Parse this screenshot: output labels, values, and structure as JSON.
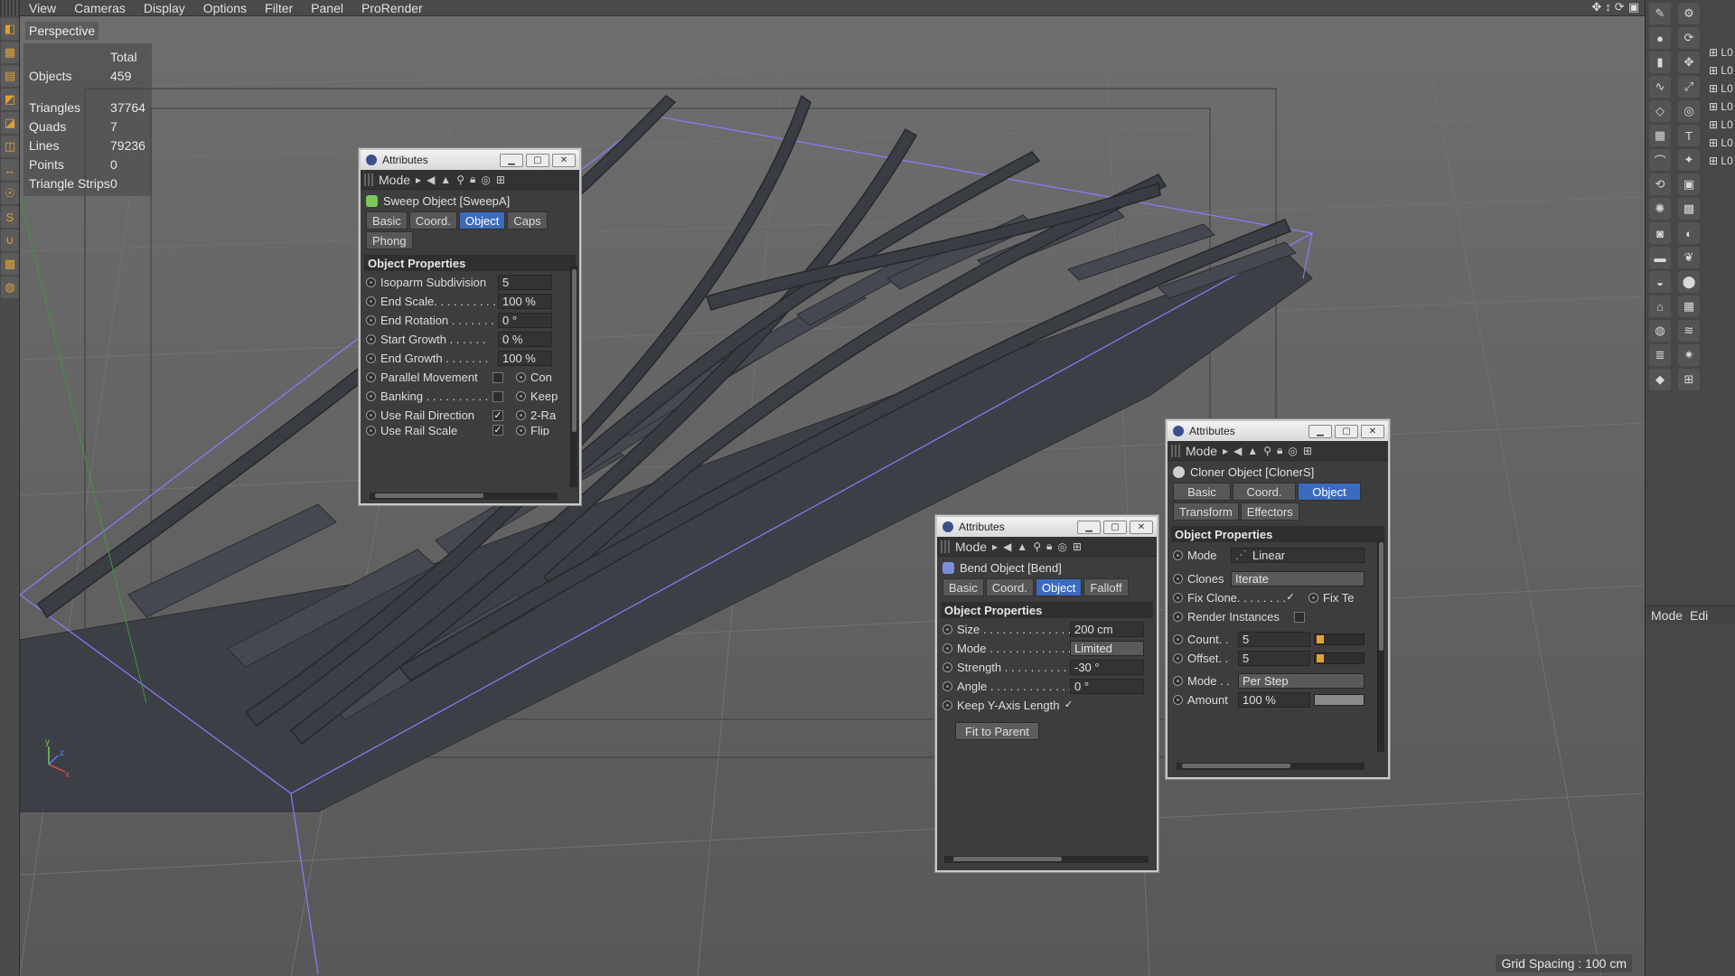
{
  "menu": {
    "items": [
      "View",
      "Cameras",
      "Display",
      "Options",
      "Filter",
      "Panel",
      "ProRender"
    ]
  },
  "viewport": {
    "name": "Perspective",
    "grid_spacing": "Grid Spacing : 100 cm"
  },
  "stats": {
    "total_label": "Total",
    "objects_label": "Objects",
    "objects_value": "459",
    "triangles_label": "Triangles",
    "triangles_value": "37764",
    "quads_label": "Quads",
    "quads_value": "7",
    "lines_label": "Lines",
    "lines_value": "79236",
    "points_label": "Points",
    "points_value": "0",
    "strips_label": "Triangle Strips",
    "strips_value": "0"
  },
  "right_panel": {
    "mode_label": "Mode",
    "edit_label": "Edi",
    "layer_label": "L0"
  },
  "sweep_panel": {
    "title": "Attributes",
    "mode_label": "Mode",
    "object_name": "Sweep Object [SweepA]",
    "tabs": [
      "Basic",
      "Coord.",
      "Object",
      "Caps",
      "Phong"
    ],
    "active_tab": "Object",
    "section": "Object Properties",
    "props": {
      "isoparm_label": "Isoparm Subdivision",
      "isoparm_value": "5",
      "end_scale_label": "End Scale. . . . . . . . . .",
      "end_scale_value": "100 %",
      "end_rotation_label": "End Rotation . . . . . . .",
      "end_rotation_value": "0 °",
      "start_growth_label": "Start Growth . . . . . .",
      "start_growth_value": "0 %",
      "end_growth_label": "End Growth . . . . . . .",
      "end_growth_value": "100 %",
      "parallel_label": "Parallel Movement",
      "parallel_right": "Con",
      "banking_label": "Banking . . . . . . . . . .",
      "banking_right": "Keep",
      "rail_dir_label": "Use Rail Direction",
      "rail_dir_right": "2-Ra",
      "rail_scale_label": "Use Rail Scale",
      "rail_scale_right": "Flip"
    }
  },
  "bend_panel": {
    "title": "Attributes",
    "mode_label": "Mode",
    "object_name": "Bend Object [Bend]",
    "tabs": [
      "Basic",
      "Coord.",
      "Object",
      "Falloff"
    ],
    "active_tab": "Object",
    "section": "Object Properties",
    "props": {
      "size_label": "Size . . . . . . . . . . . . . .",
      "size_value": "200 cm",
      "mode_label": "Mode . . . . . . . . . . . . .",
      "mode_value": "Limited",
      "strength_label": "Strength . . . . . . . . . .",
      "strength_value": "-30 °",
      "angle_label": "Angle . . . . . . . . . . . . .",
      "angle_value": "0 °",
      "keep_y_label": "Keep Y-Axis Length"
    },
    "fit_button": "Fit to Parent"
  },
  "cloner_panel": {
    "title": "Attributes",
    "mode_label": "Mode",
    "object_name": "Cloner Object [ClonerS]",
    "tabs": [
      "Basic",
      "Coord.",
      "Object",
      "Transform",
      "Effectors"
    ],
    "active_tab": "Object",
    "section": "Object Properties",
    "props": {
      "mode_label": "Mode",
      "mode_value": "Linear",
      "clones_label": "Clones",
      "clones_value": "Iterate",
      "fix_clone_label": "Fix Clone. . . . . . . .",
      "fix_tex_label": "Fix Te",
      "render_inst_label": "Render Instances",
      "count_label": "Count. .",
      "count_value": "5",
      "offset_label": "Offset. .",
      "offset_value": "5",
      "step_mode_label": "Mode . .",
      "step_mode_value": "Per Step",
      "amount_label": "Amount",
      "amount_value": "100 %"
    }
  },
  "colors": {
    "accent": "#3b6bbf",
    "bbox": "#8b7bff",
    "rail": "#3a3d44",
    "ground": "#3c3f45",
    "slider": "#e6a030"
  }
}
